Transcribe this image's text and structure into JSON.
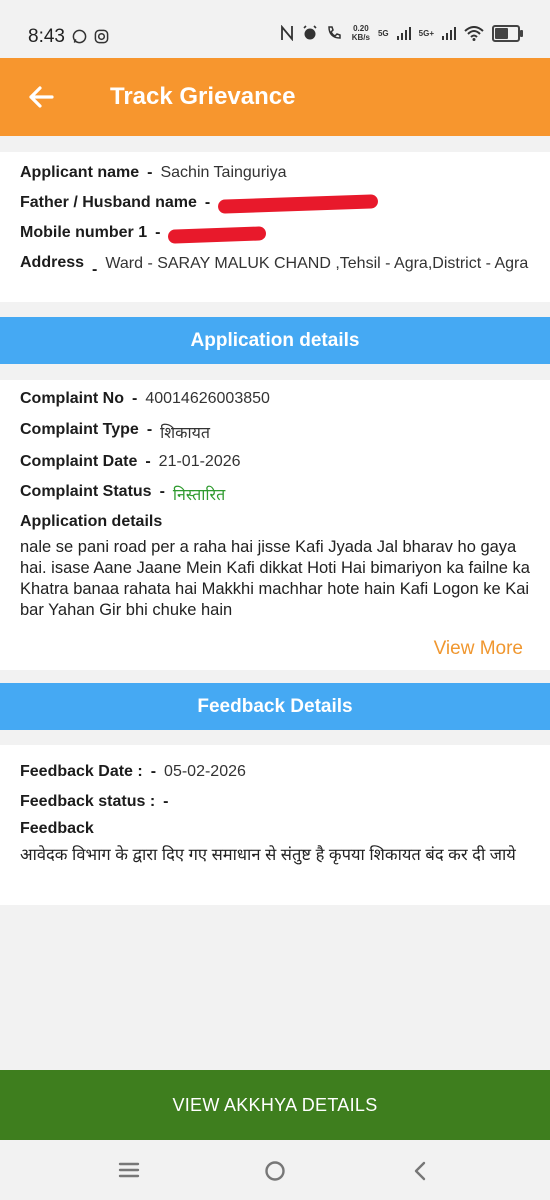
{
  "status_bar": {
    "time": "8:43",
    "speed": "0.20",
    "speed_unit": "KB/s",
    "net1": "5G",
    "net2": "5G+"
  },
  "header": {
    "title": "Track Grievance"
  },
  "applicant": {
    "name_label": "Applicant name",
    "name_value": "Sachin Tainguriya",
    "father_label": "Father / Husband name",
    "mobile_label": "Mobile number 1",
    "address_label": "Address",
    "address_value": "Ward - SARAY MALUK CHAND ,Tehsil - Agra,District - Agra"
  },
  "application_section": {
    "title": "Application details",
    "complaint_no_label": "Complaint No",
    "complaint_no_value": "40014626003850",
    "complaint_type_label": "Complaint Type",
    "complaint_type_value": "शिकायत",
    "complaint_date_label": "Complaint Date",
    "complaint_date_value": "21-01-2026",
    "complaint_status_label": "Complaint Status",
    "complaint_status_value": "निस्तारित",
    "details_label": "Application details",
    "details_text": "nale se pani road per a raha hai jisse Kafi Jyada Jal bharav ho gaya hai. isase Aane Jaane Mein Kafi dikkat Hoti Hai bimariyon ka failne ka Khatra banaa rahata hai Makkhi machhar hote hain Kafi Logon ke Kai bar Yahan Gir bhi chuke hain",
    "view_more": "View More",
    "status_color": "#2e9a2e"
  },
  "feedback_section": {
    "title": "Feedback Details",
    "date_label": "Feedback Date :",
    "date_value": "05-02-2026",
    "status_label": "Feedback status :",
    "status_value": "",
    "feedback_label": "Feedback",
    "feedback_text": "आवेदक विभाग के द्वारा दिए गए समाधान से संतुष्ट है कृपया शिकायत बंद कर दी जाये"
  },
  "action": {
    "label": "VIEW AKKHYA DETAILS"
  },
  "colors": {
    "header": "#f7962e",
    "section": "#45a9f3",
    "action": "#3e7e1e",
    "view_more": "#f0972f"
  }
}
